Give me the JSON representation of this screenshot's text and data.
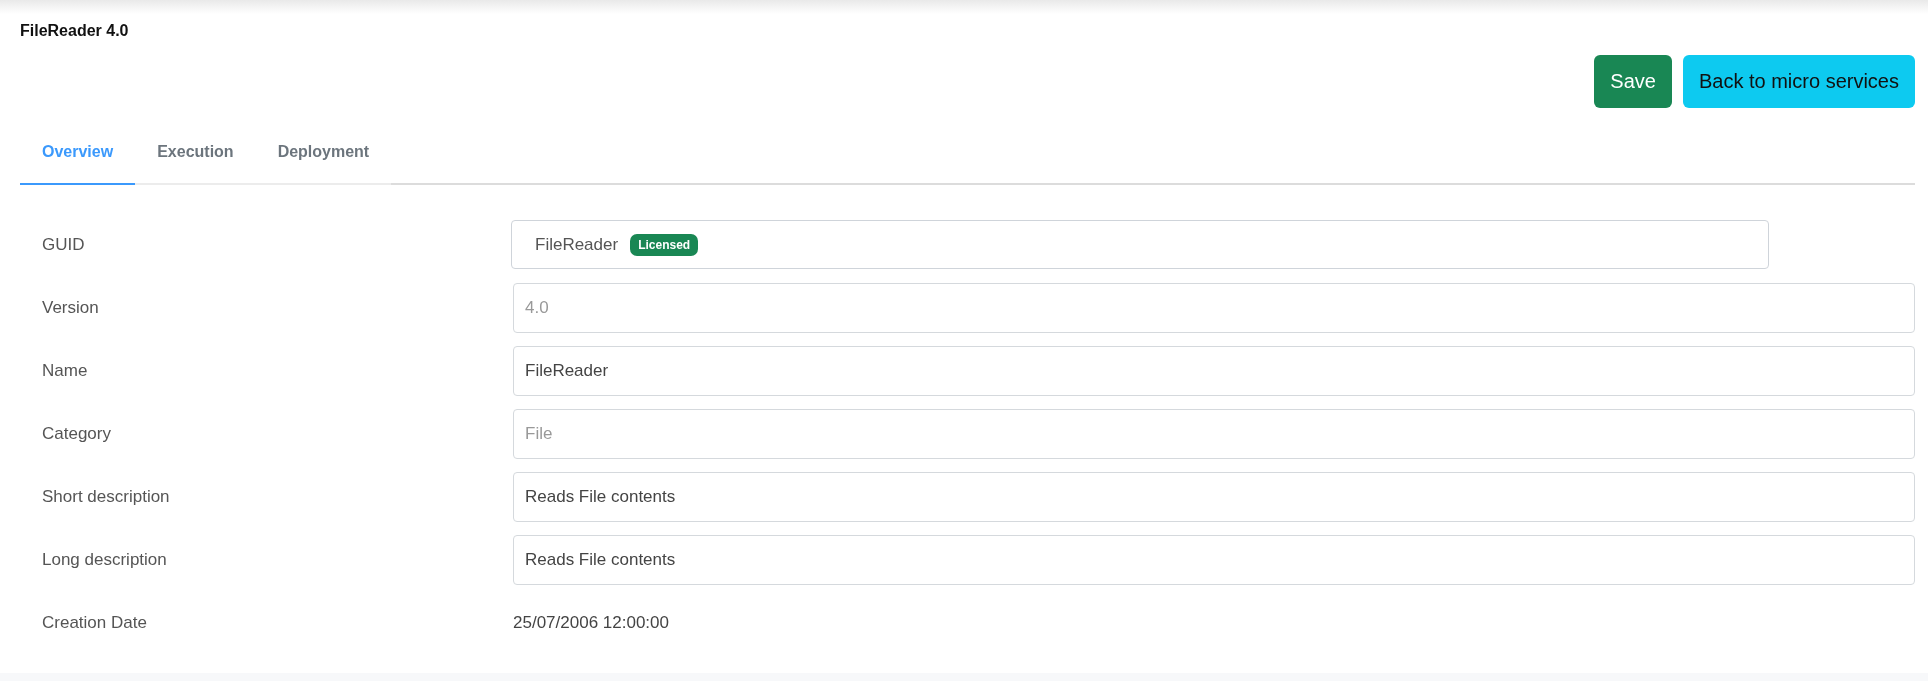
{
  "title": "FileReader 4.0",
  "buttons": [
    {
      "label": "Save",
      "kind": "primary"
    },
    {
      "label": "Back to micro services",
      "kind": "info"
    }
  ],
  "tabs": [
    {
      "label": "Overview",
      "selected": true
    },
    {
      "label": "Execution",
      "selected": false
    },
    {
      "label": "Deployment",
      "selected": false
    }
  ],
  "fields": [
    {
      "label": "GUID",
      "kind": "guid",
      "value": "FileReader",
      "badge": "Licensed"
    },
    {
      "label": "Version",
      "kind": "input",
      "placeholder": "4.0"
    },
    {
      "label": "Name",
      "kind": "input",
      "value": "FileReader"
    },
    {
      "label": "Category",
      "kind": "input",
      "placeholder": "File"
    },
    {
      "label": "Short description",
      "kind": "input",
      "value": "Reads File contents"
    },
    {
      "label": "Long description",
      "kind": "input",
      "value": "Reads File contents"
    },
    {
      "label": "Creation Date",
      "kind": "text",
      "value": "25/07/2006 12:00:00"
    }
  ]
}
